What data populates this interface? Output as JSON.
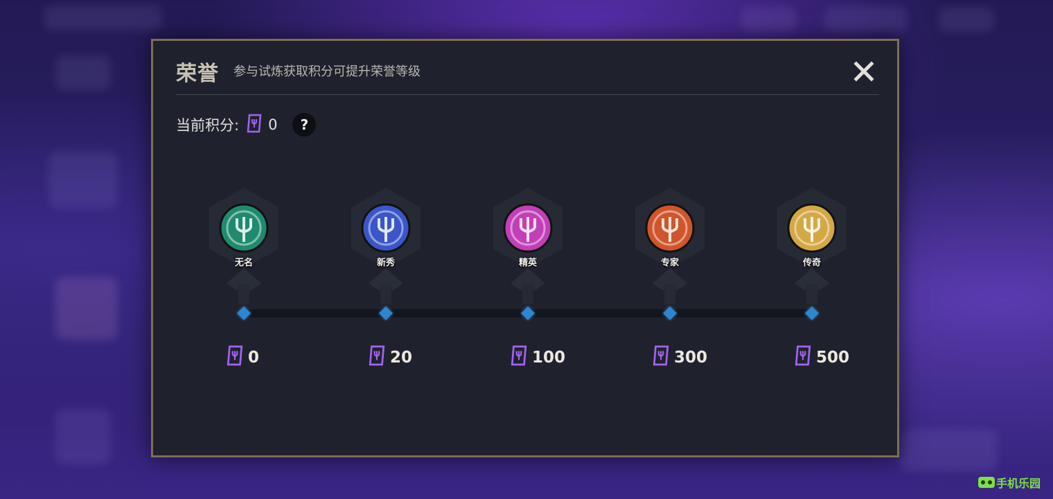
{
  "dialog": {
    "title": "荣誉",
    "subtitle": "参与试炼获取积分可提升荣誉等级",
    "close_icon": "close-icon"
  },
  "current_points": {
    "label": "当前积分:",
    "value": "0",
    "icon": "honor-point-icon",
    "help_label": "?"
  },
  "tiers": [
    {
      "name": "无名",
      "points": "0",
      "color": "#1f8a6e"
    },
    {
      "name": "新秀",
      "points": "20",
      "color": "#3a56c8"
    },
    {
      "name": "精英",
      "points": "100",
      "color": "#c23fb8"
    },
    {
      "name": "专家",
      "points": "300",
      "color": "#d0552a"
    },
    {
      "name": "传奇",
      "points": "500",
      "color": "#d4a845"
    }
  ],
  "colors": {
    "accent_purple": "#a463f2",
    "diamond_blue": "#2f86d0",
    "frame_gold": "#7e6e55"
  },
  "watermark": {
    "text": "手机乐园"
  }
}
